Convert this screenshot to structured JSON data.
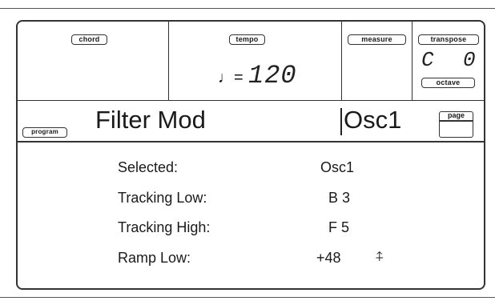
{
  "header": {
    "chord_tag": "chord",
    "tempo_tag": "tempo",
    "tempo_note_glyph": "♩=",
    "tempo_value": "120",
    "measure_tag": "measure",
    "transpose_tag": "transpose",
    "transpose_value_left": "C",
    "transpose_value_right": "0",
    "octave_tag": "octave"
  },
  "title_bar": {
    "program_tag": "program",
    "title": "Filter Mod",
    "page_label": "Osc1",
    "page_tag": "page"
  },
  "params": [
    {
      "label": "Selected:",
      "value": "Osc1"
    },
    {
      "label": "Tracking Low:",
      "value": "B 3"
    },
    {
      "label": "Tracking High:",
      "value": "F 5"
    },
    {
      "label": "Ramp Low:",
      "value": "+48"
    }
  ],
  "icons": {
    "scroll": "up-down-arrows-icon"
  }
}
